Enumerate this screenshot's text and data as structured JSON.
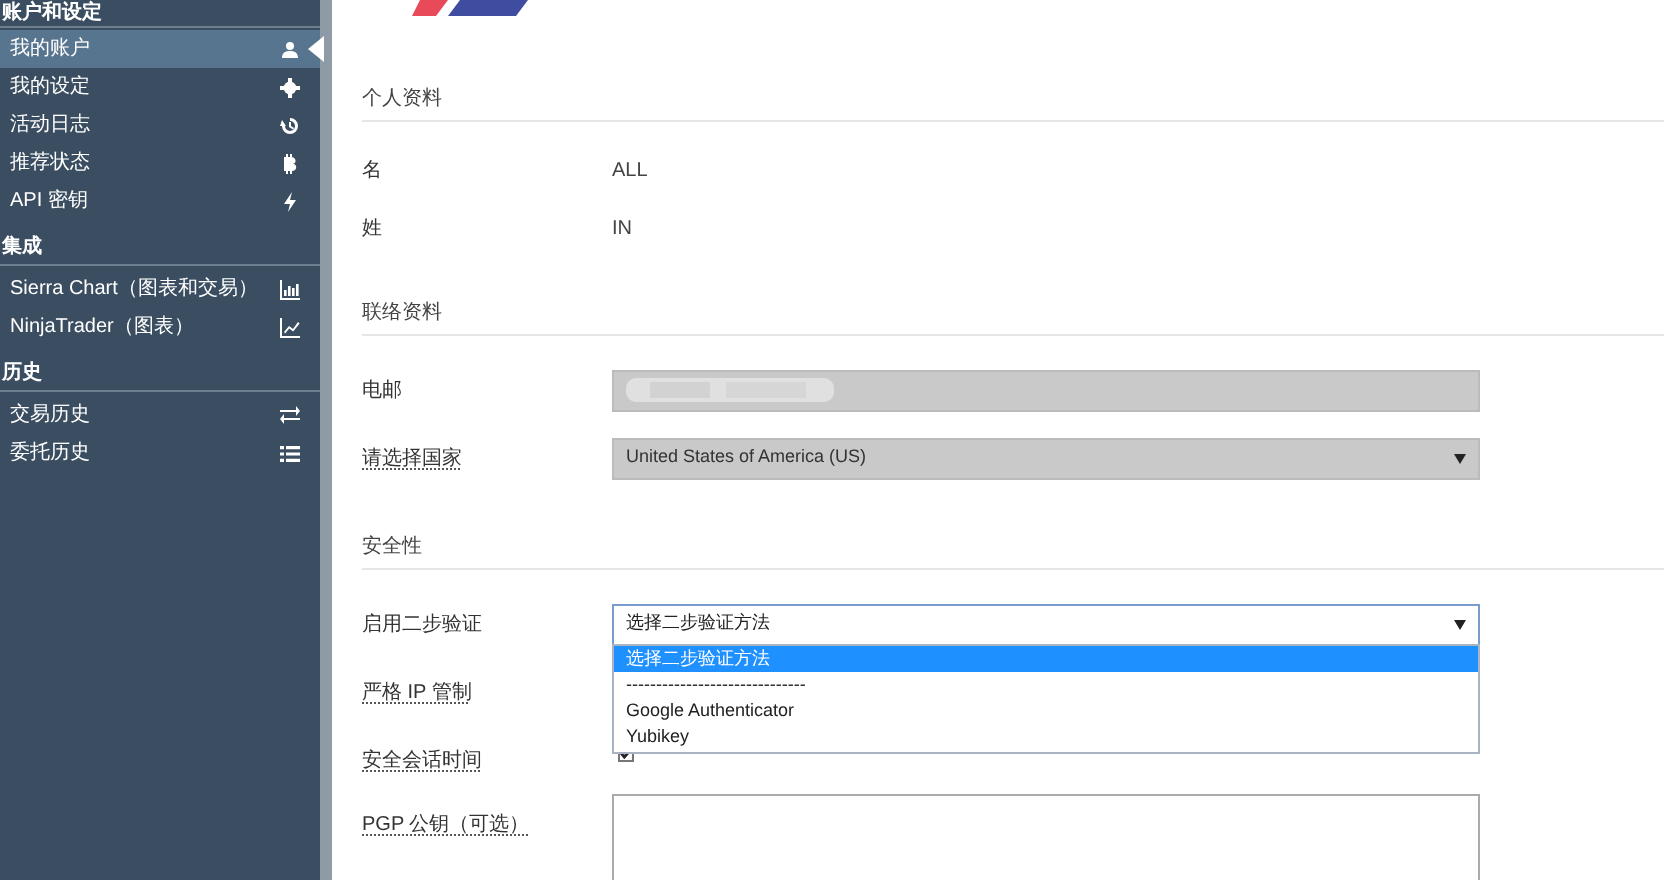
{
  "sidebar": {
    "sections": [
      {
        "heading": "账户和设定",
        "items": [
          {
            "label": "我的账户",
            "selected": true
          },
          {
            "label": "我的设定",
            "selected": false
          },
          {
            "label": "活动日志",
            "selected": false
          },
          {
            "label": "推荐状态",
            "selected": false
          },
          {
            "label": "API 密钥",
            "selected": false
          }
        ]
      },
      {
        "heading": "集成",
        "items": [
          {
            "label": "Sierra Chart（图表和交易）",
            "selected": false
          },
          {
            "label": "NinjaTrader（图表）",
            "selected": false
          }
        ]
      },
      {
        "heading": "历史",
        "items": [
          {
            "label": "交易历史",
            "selected": false
          },
          {
            "label": "委托历史",
            "selected": false
          }
        ]
      }
    ]
  },
  "main": {
    "sections": [
      {
        "heading": "个人资料",
        "rows": [
          {
            "kind": "text",
            "label": "名",
            "value": "ALL",
            "tooltip": false
          },
          {
            "kind": "text",
            "label": "姓",
            "value": "IN",
            "tooltip": false
          }
        ]
      },
      {
        "heading": "联络资料",
        "rows": [
          {
            "kind": "field",
            "label": "电邮",
            "disabled": true,
            "tooltip": false
          },
          {
            "kind": "select",
            "label": "请选择国家",
            "value": "United States of America (US)",
            "disabled": true,
            "tooltip": true
          }
        ]
      },
      {
        "heading": "安全性",
        "rows": [
          {
            "kind": "select",
            "label": "启用二步验证",
            "value": "选择二步验证方法",
            "disabled": false,
            "tooltip": false,
            "expanded": true,
            "options": [
              {
                "label": "选择二步验证方法",
                "selected": true
              },
              {
                "label": "------------------------------",
                "selected": false
              },
              {
                "label": "Google Authenticator",
                "selected": false
              },
              {
                "label": "Yubikey",
                "selected": false
              }
            ]
          },
          {
            "kind": "label",
            "label": "严格 IP 管制",
            "tooltip": true
          },
          {
            "kind": "checkbox",
            "label": "安全会话时间",
            "checked": true,
            "tooltip": true
          },
          {
            "kind": "textarea",
            "label": "PGP 公钥（可选）",
            "tooltip": true
          }
        ]
      }
    ]
  }
}
